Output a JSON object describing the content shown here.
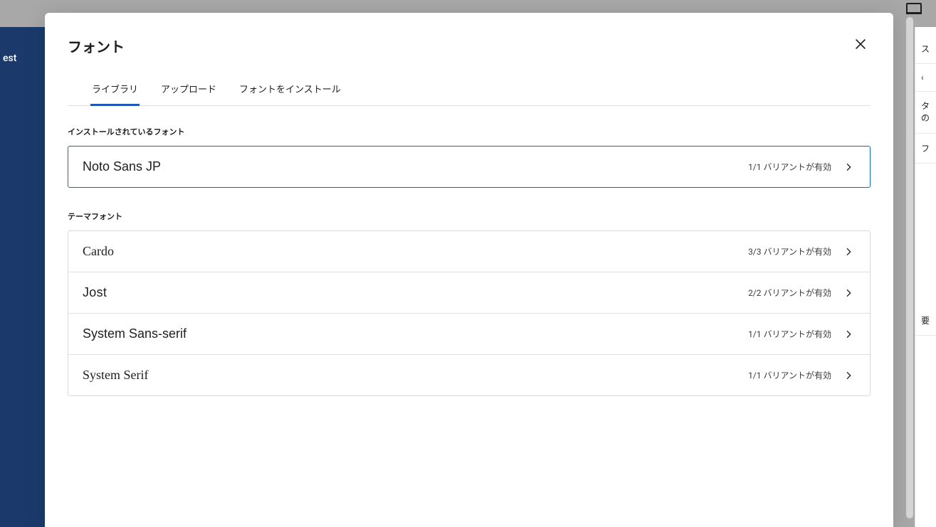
{
  "background": {
    "left_sidebar_text": "est",
    "topright_icon": "laptop-icon",
    "right_panel_items": [
      "ス",
      "‹",
      "タ\nの",
      "フ",
      "要"
    ]
  },
  "modal": {
    "title": "フォント",
    "close_aria": "Close",
    "tabs": [
      {
        "id": "library",
        "label": "ライブラリ",
        "active": true
      },
      {
        "id": "upload",
        "label": "アップロード",
        "active": false
      },
      {
        "id": "install",
        "label": "フォントをインストール",
        "active": false
      }
    ],
    "sections": {
      "installed": {
        "label": "インストールされているフォント",
        "fonts": [
          {
            "name": "Noto Sans JP",
            "style": "sans",
            "variants": "1/1 バリアントが有効",
            "selected": true
          }
        ]
      },
      "theme": {
        "label": "テーマフォント",
        "fonts": [
          {
            "name": "Cardo",
            "style": "serif",
            "variants": "3/3 バリアントが有効"
          },
          {
            "name": "Jost",
            "style": "jost",
            "variants": "2/2 バリアントが有効"
          },
          {
            "name": "System Sans-serif",
            "style": "sans",
            "variants": "1/1 バリアントが有効"
          },
          {
            "name": "System Serif",
            "style": "serif",
            "variants": "1/1 バリアントが有効"
          }
        ]
      }
    }
  }
}
